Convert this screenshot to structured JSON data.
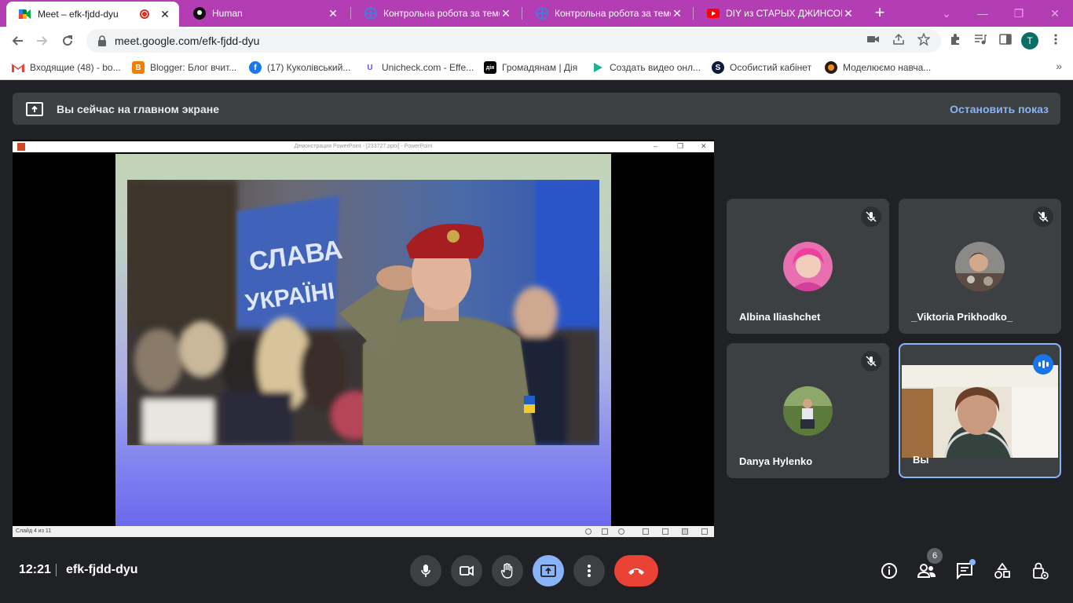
{
  "browser": {
    "tabs": [
      {
        "title": "Meet – efk-fjdd-dyu",
        "active": true,
        "icon": "google-meet-icon"
      },
      {
        "title": "Human",
        "active": false,
        "icon": "human-site-icon"
      },
      {
        "title": "Контрольна робота за темо",
        "active": false,
        "icon": "quiz-icon"
      },
      {
        "title": "Контрольна робота за темо",
        "active": false,
        "icon": "quiz-icon"
      },
      {
        "title": "DIY из СТАРЫХ ДЖИНСОВ",
        "active": false,
        "icon": "youtube-icon"
      }
    ],
    "close_glyph": "✕",
    "new_tab_glyph": "+",
    "url": "meet.google.com/efk-fjdd-dyu",
    "profile_initial": "T",
    "tabstrip_color": "#b33db3"
  },
  "bookmarks": [
    {
      "label": "Входящие (48) - bo...",
      "icon": "gmail-icon"
    },
    {
      "label": "Blogger: Блог вчит...",
      "icon": "blogger-icon"
    },
    {
      "label": "(17) Куколівський...",
      "icon": "facebook-icon"
    },
    {
      "label": "Unicheck.com - Effe...",
      "icon": "unicheck-icon"
    },
    {
      "label": "Громадянам | Дія",
      "icon": "diia-icon"
    },
    {
      "label": "Создать видео онл...",
      "icon": "play-icon"
    },
    {
      "label": "Особистий кабінет",
      "icon": "cabinet-icon"
    },
    {
      "label": "Моделюємо навча...",
      "icon": "model-icon"
    }
  ],
  "banner": {
    "text": "Вы сейчас на главном экране",
    "stop_label": "Остановить показ"
  },
  "presentation": {
    "window_title": "Демонстрация PowerPoint - [233727.pptx] - PowerPoint",
    "slide_status": "Слайд 4 из 11",
    "sign_text_1": "СЛАВА",
    "sign_text_2": "УКРАЇНІ"
  },
  "participants": [
    {
      "name": "Albina Iliashchet",
      "muted": true
    },
    {
      "name": "_Viktoria Prikhodko_",
      "muted": true
    },
    {
      "name": "Danya Hylenko",
      "muted": true
    },
    {
      "name": "Вы",
      "speaking": true
    }
  ],
  "meeting": {
    "time": "12:21",
    "code": "efk-fjdd-dyu",
    "participant_count": "6"
  },
  "colors": {
    "background": "#202124",
    "tile": "#3c4043",
    "accent": "#8ab4f8",
    "end_call": "#ea4335"
  }
}
